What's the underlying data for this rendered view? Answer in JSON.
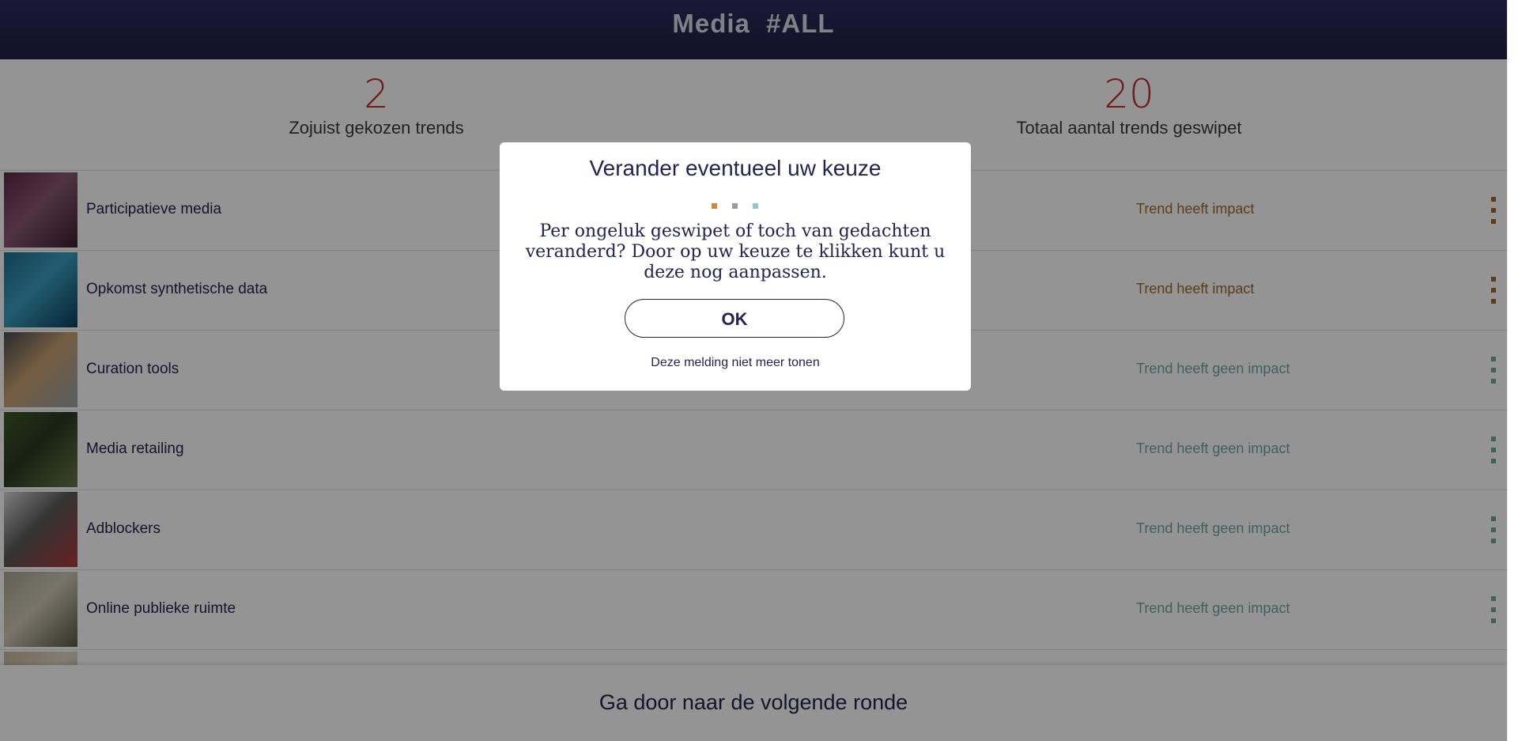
{
  "header": {
    "title": "Media  #ALL"
  },
  "stats": {
    "chosen": {
      "value": "2",
      "label": "Zojuist gekozen trends"
    },
    "total": {
      "value": "20",
      "label": "Totaal aantal trends geswipet"
    }
  },
  "colors": {
    "accent_red": "#c2332a",
    "impact": "#a06a28",
    "no_impact": "#6fa6a4",
    "navy": "#25234f"
  },
  "trends": [
    {
      "name": "Participatieve media",
      "status": "Trend heeft impact",
      "impact": true,
      "thumb_colors": [
        "#5a2a45",
        "#3a1c2f",
        "#8c5a74"
      ]
    },
    {
      "name": "Opkomst synthetische data",
      "status": "Trend heeft impact",
      "impact": true,
      "thumb_colors": [
        "#1f6f8f",
        "#0c3f5a",
        "#3aa0c0"
      ]
    },
    {
      "name": "Curation tools",
      "status": "Trend heeft geen impact",
      "impact": false,
      "thumb_colors": [
        "#4a4a52",
        "#9aa0a8",
        "#c8a070"
      ]
    },
    {
      "name": "Media retailing",
      "status": "Trend heeft geen impact",
      "impact": false,
      "thumb_colors": [
        "#3d5a2a",
        "#6a7a4a",
        "#2a3a20"
      ]
    },
    {
      "name": "Adblockers",
      "status": "Trend heeft geen impact",
      "impact": false,
      "thumb_colors": [
        "#d8d8d8",
        "#b03a3a",
        "#5a5a5a"
      ]
    },
    {
      "name": "Online publieke ruimte",
      "status": "Trend heeft geen impact",
      "impact": false,
      "thumb_colors": [
        "#a8a890",
        "#5a5a48",
        "#d0c8b8"
      ]
    },
    {
      "name": "",
      "status": "",
      "impact": false,
      "thumb_colors": [
        "#c8b89a",
        "#a89878",
        "#e0d8c8"
      ]
    }
  ],
  "footer": {
    "next_label": "Ga door naar de volgende ronde"
  },
  "modal": {
    "title": "Verander eventueel uw keuze",
    "body": "Per ongeluk geswipet of toch van gedachten veranderd? Door op uw keuze te klikken kunt u deze nog aanpassen.",
    "ok_label": "OK",
    "dismiss_label": "Deze melding niet meer tonen",
    "dot_colors": [
      "#c98a3a",
      "#9a9aa0",
      "#8ec8c8"
    ]
  }
}
